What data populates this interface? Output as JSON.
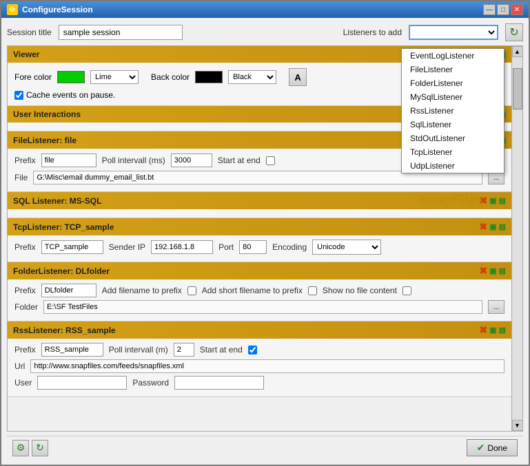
{
  "window": {
    "title": "ConfigureSession"
  },
  "titlebar": {
    "minimize": "—",
    "maximize": "□",
    "close": "✕"
  },
  "top": {
    "session_label": "Session title",
    "session_value": "sample session",
    "listeners_label": "Listeners to add",
    "refresh_icon": "↻"
  },
  "dropdown": {
    "items": [
      "EventLogListener",
      "FileListener",
      "FolderListener",
      "MySqlListener",
      "RssListener",
      "SqlListener",
      "StdOutListener",
      "TcpListener",
      "UdpListener"
    ]
  },
  "sections": [
    {
      "id": "viewer",
      "title": "Viewer",
      "body_type": "viewer",
      "fore_color_label": "Fore color",
      "fore_color_swatch": "#00cc00",
      "fore_color_name": "Lime",
      "back_color_label": "Back color",
      "back_color_swatch": "#000000",
      "back_color_name": "Black",
      "cache_label": "Cache events on pause."
    },
    {
      "id": "user-interactions",
      "title": "User Interactions",
      "body_type": "empty"
    },
    {
      "id": "file-listener",
      "title": "FileListener: file",
      "body_type": "file",
      "prefix_label": "Prefix",
      "prefix_value": "file",
      "poll_label": "Poll intervall (ms)",
      "poll_value": "3000",
      "start_label": "Start at end",
      "file_label": "File",
      "file_path": "G:\\Misc\\email dummy_email_list.bt"
    },
    {
      "id": "sql-listener",
      "title": "SQL Listener: MS-SQL",
      "body_type": "watermark",
      "watermark": "SnapFiles"
    },
    {
      "id": "tcp-listener",
      "title": "TcpListener: TCP_sample",
      "body_type": "tcp",
      "prefix_label": "Prefix",
      "prefix_value": "TCP_sample",
      "sender_label": "Sender IP",
      "sender_value": "192.168.1.8",
      "port_label": "Port",
      "port_value": "80",
      "encoding_label": "Encoding",
      "encoding_value": "Unicode"
    },
    {
      "id": "folder-listener",
      "title": "FolderListener: DLfolder",
      "body_type": "folder",
      "prefix_label": "Prefix",
      "prefix_value": "DLfolder",
      "add_filename_label": "Add filename to prefix",
      "add_short_label": "Add short filename to prefix",
      "no_file_label": "Show no file content",
      "folder_label": "Folder",
      "folder_path": "E:\\SF TestFiles"
    },
    {
      "id": "rss-listener",
      "title": "RssListener: RSS_sample",
      "body_type": "rss",
      "prefix_label": "Prefix",
      "prefix_value": "RSS_sample",
      "poll_label": "Poll intervall (m)",
      "poll_value": "2",
      "start_label": "Start at end",
      "url_label": "Url",
      "url_value": "http://www.snapfiles.com/feeds/snapfiles.xml",
      "user_label": "User",
      "user_value": "",
      "password_label": "Password",
      "password_value": ""
    }
  ],
  "bottom": {
    "done_label": "Done",
    "done_icon": "✔"
  }
}
